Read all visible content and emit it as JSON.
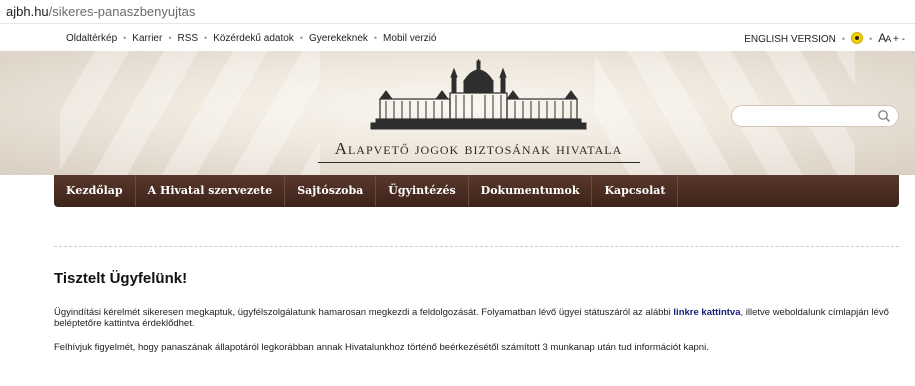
{
  "browser": {
    "url_host": "ajbh.hu",
    "url_path": "/sikeres-panaszbenyujtas"
  },
  "top_links": [
    "Oldaltérkép",
    "Karrier",
    "RSS",
    "Közérdekű adatok",
    "Gyerekeknek",
    "Mobil verzió"
  ],
  "right_links": {
    "english": "ENGLISH VERSION",
    "font_size": "A",
    "font_size_small": "A",
    "plus_minus": "+ -"
  },
  "logo": {
    "text": "Alapvető jogok biztosának hivatala"
  },
  "search": {
    "placeholder": "",
    "value": ""
  },
  "nav": [
    "Kezdőlap",
    "A Hivatal szervezete",
    "Sajtószoba",
    "Ügyintézés",
    "Dokumentumok",
    "Kapcsolat"
  ],
  "content": {
    "heading": "Tisztelt Ügyfelünk!",
    "para1_before": "Ügyindítási kérelmét sikeresen megkaptuk, ügyfélszolgálatunk hamarosan megkezdi a feldolgozását. Folyamatban lévő ügyei státuszáról az alábbi ",
    "para1_link": "linkre kattintva",
    "para1_after": ", illetve weboldalunk címlapján lévő beléptetőre kattintva érdeklődhet.",
    "para2": "Felhívjuk figyelmét, hogy panaszának állapotáról legkorábban annak Hivatalunkhoz történő beérkezésétől számított 3 munkanap után tud információt kapni."
  },
  "colors": {
    "nav_bg": "#4a2c21",
    "link": "#1a1a7a",
    "header_bg": "#efe8dd"
  }
}
